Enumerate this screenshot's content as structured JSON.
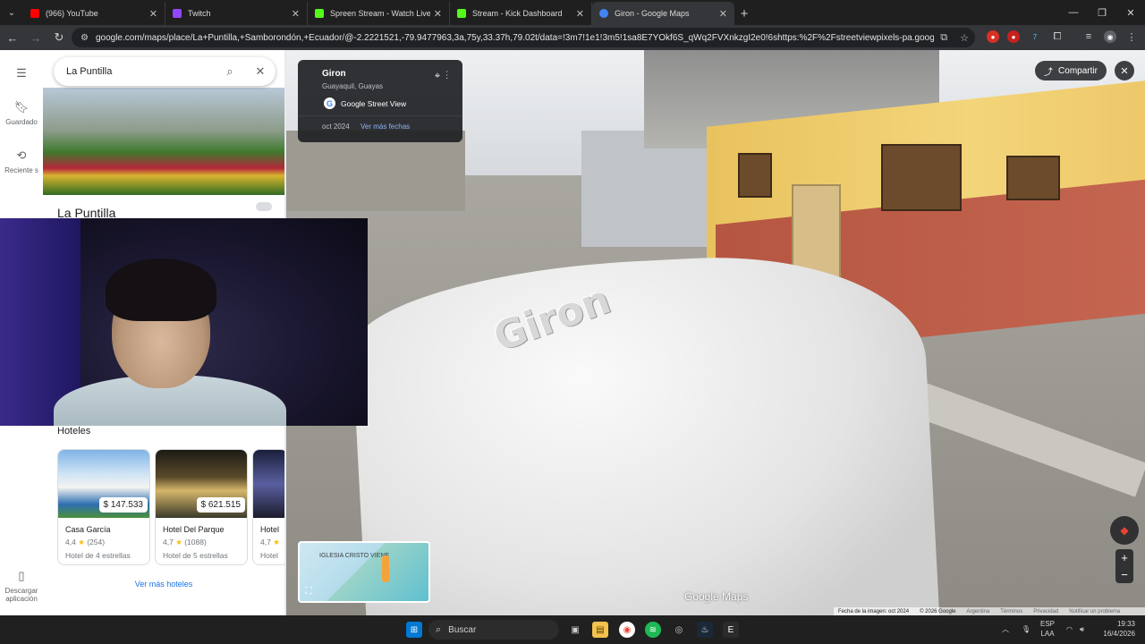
{
  "browser": {
    "tabs": [
      {
        "title": "(966) YouTube",
        "color": "#ff0000"
      },
      {
        "title": "Twitch",
        "color": "#9146ff"
      },
      {
        "title": "Spreen Stream - Watch Live on",
        "color": "#53fc18"
      },
      {
        "title": "Stream - Kick Dashboard",
        "color": "#53fc18"
      },
      {
        "title": "Giron - Google Maps",
        "color": "#4285f4"
      }
    ],
    "url": "google.com/maps/place/La+Puntilla,+Samborondón,+Ecuador/@-2.2221521,-79.9477963,3a,75y,33.37h,79.02t/data=!3m7!1e1!3m5!1sa8E7YOkf6S_qWq2FVXnkzgI2e0!6shttps:%2F%2Fstreetviewpixels-pa.googleapis.com%2Fv1..."
  },
  "rail": {
    "saved": "Guardado",
    "recent": "Reciente s",
    "download": "Descargar aplicación"
  },
  "panel": {
    "search_value": "La Puntilla",
    "place_title": "La Puntilla",
    "hotels_heading": "Hoteles",
    "hotels": [
      {
        "price": "$ 147.533",
        "name": "Casa García",
        "rating": "4,4",
        "reviews": "(254)",
        "class": "Hotel de 4 estrellas"
      },
      {
        "price": "$ 621.515",
        "name": "Hotel Del Parque",
        "rating": "4,7",
        "reviews": "(1088)",
        "class": "Hotel de 5 estrellas"
      },
      {
        "price": "",
        "name": "Hotel",
        "rating": "4,7",
        "reviews": "",
        "class": "Hotel"
      }
    ],
    "more_hotels": "Ver más hoteles"
  },
  "streetview": {
    "place_name": "Giron",
    "place_sub": "Guayaquil, Guayas",
    "provider": "Google Street View",
    "date": "oct 2024",
    "more_dates": "Ver más fechas",
    "share": "Compartir",
    "car_text": "Giron",
    "watermark": "Google Maps",
    "minimap_label": "IGLESIA CRISTO VIENE",
    "footer": {
      "image_date": "Fecha de la imagen: oct 2024",
      "copyright": "© 2026 Google",
      "country": "Argentina",
      "terms": "Términos",
      "privacy": "Privacidad",
      "report": "Notificar un problema"
    }
  },
  "taskbar": {
    "search_label": "Buscar",
    "lang": "ESP",
    "layout": "LAA",
    "time": "19:33",
    "date": "16/4/2026"
  }
}
